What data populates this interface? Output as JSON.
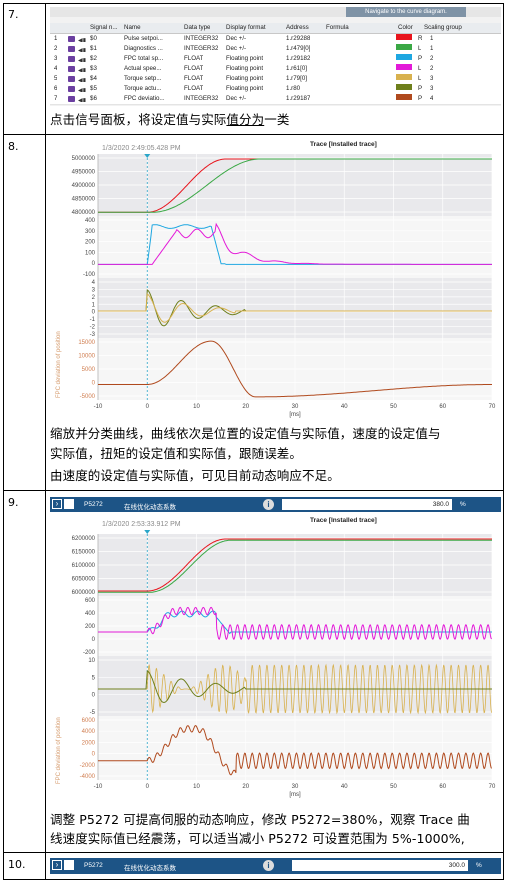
{
  "steps": [
    {
      "num": "7."
    },
    {
      "num": "8."
    },
    {
      "num": "9."
    },
    {
      "num": "10."
    }
  ],
  "step7": {
    "nav_label": "Navigate to the curve diagram.",
    "headers": [
      "Signal n...",
      "Name",
      "Data type",
      "Display format",
      "Address",
      "Formula",
      "Color",
      "Scaling group"
    ],
    "rows": [
      {
        "idx": "1",
        "sig": "$0",
        "name": "Pulse setpoi...",
        "type": "INTEGER32",
        "fmt": "Dec +/-",
        "addr": "1.r29288",
        "color": "#e8141c",
        "grp_letter": "R",
        "grp": "1"
      },
      {
        "idx": "2",
        "sig": "$1",
        "name": "Diagnostics ...",
        "type": "INTEGER32",
        "fmt": "Dec +/-",
        "addr": "1.r479[0]",
        "color": "#3aa845",
        "grp_letter": "L",
        "grp": "1"
      },
      {
        "idx": "3",
        "sig": "$2",
        "name": "FPC total sp...",
        "type": "FLOAT",
        "fmt": "Floating point",
        "addr": "1.r29182",
        "color": "#1ea7e1",
        "grp_letter": "P",
        "grp": "2"
      },
      {
        "idx": "4",
        "sig": "$3",
        "name": "Actual spee...",
        "type": "FLOAT",
        "fmt": "Floating point",
        "addr": "1.r61[0]",
        "color": "#e31ad8",
        "grp_letter": "L",
        "grp": "2"
      },
      {
        "idx": "5",
        "sig": "$4",
        "name": "Torque setp...",
        "type": "FLOAT",
        "fmt": "Floating point",
        "addr": "1.r79[0]",
        "color": "#d8b14e",
        "grp_letter": "L",
        "grp": "3"
      },
      {
        "idx": "6",
        "sig": "$5",
        "name": "Torque actu...",
        "type": "FLOAT",
        "fmt": "Floating point",
        "addr": "1.r80",
        "color": "#6e7f1c",
        "grp_letter": "P",
        "grp": "3"
      },
      {
        "idx": "7",
        "sig": "$6",
        "name": "FPC deviatio...",
        "type": "INTEGER32",
        "fmt": "Dec +/-",
        "addr": "1.r29187",
        "color": "#b04a1e",
        "grp_letter": "P",
        "grp": "4"
      }
    ],
    "caption_pre": "点击信号面板，将设定值与实际",
    "caption_u": "值分为",
    "caption_post": "一类"
  },
  "step8": {
    "timestamp": "1/3/2020 2:49:05.428 PM",
    "trace_title": "Trace [Installed trace]",
    "ylabel_rot": "FPC deviation of position",
    "pos_ticks": [
      "5000000",
      "4950000",
      "4900000",
      "4850000",
      "4800000"
    ],
    "spd_ticks": [
      "400",
      "300",
      "200",
      "100",
      "0",
      "-100"
    ],
    "trq_ticks": [
      "4",
      "3",
      "2",
      "1",
      "0",
      "-1",
      "-2",
      "-3"
    ],
    "dev_ticks": [
      "15000",
      "10000",
      "5000",
      "0",
      "-5000"
    ],
    "x_ticks": [
      "-10",
      "0",
      "10",
      "20",
      "30",
      "40",
      "50",
      "60",
      "70"
    ],
    "x_unit": "[ms]",
    "caption_lines": [
      "缩放并分类曲线，曲线依次是位置的设定值与实际值，速度的设定值与",
      "实际值，扭矩的设定值和实际值，跟随误差。",
      "由速度的设定值与实际值，可见目前动态响应不足。"
    ]
  },
  "step9": {
    "param": {
      "id": "P5272",
      "desc": "在线优化动态系数",
      "value": "380.0",
      "unit": "%"
    },
    "timestamp": "1/3/2020 2:53:33.912 PM",
    "trace_title": "Trace [Installed trace]",
    "ylabel_rot": "FPC deviation of position",
    "pos_ticks": [
      "6200000",
      "6150000",
      "6100000",
      "6050000",
      "6000000"
    ],
    "spd_ticks": [
      "600",
      "400",
      "200",
      "0",
      "-200"
    ],
    "trq_ticks": [
      "10",
      "5",
      "0",
      "-5"
    ],
    "dev_ticks": [
      "6000",
      "4000",
      "2000",
      "0",
      "-2000",
      "-4000"
    ],
    "x_ticks": [
      "-10",
      "0",
      "10",
      "20",
      "30",
      "40",
      "50",
      "60",
      "70"
    ],
    "x_unit": "[ms]",
    "caption_lines": [
      "调整 P5272 可提高伺服的动态响应，修改 P5272=380%，观察 Trace 曲",
      "线速度实际值已经震荡，可以适当减小 P5272 可设置范围为 5%-1000%,"
    ]
  },
  "step10": {
    "param": {
      "id": "P5272",
      "desc": "在线优化动态系数",
      "value": "300.0",
      "unit": "%"
    }
  },
  "colors": {
    "pos_set": "#e8141c",
    "pos_act": "#3aa845",
    "spd_set": "#1ea7e1",
    "spd_act": "#e31ad8",
    "trq_set": "#d8b14e",
    "trq_act": "#6e7f1c",
    "dev": "#b04a1e",
    "param_bar": "#1d5486"
  }
}
